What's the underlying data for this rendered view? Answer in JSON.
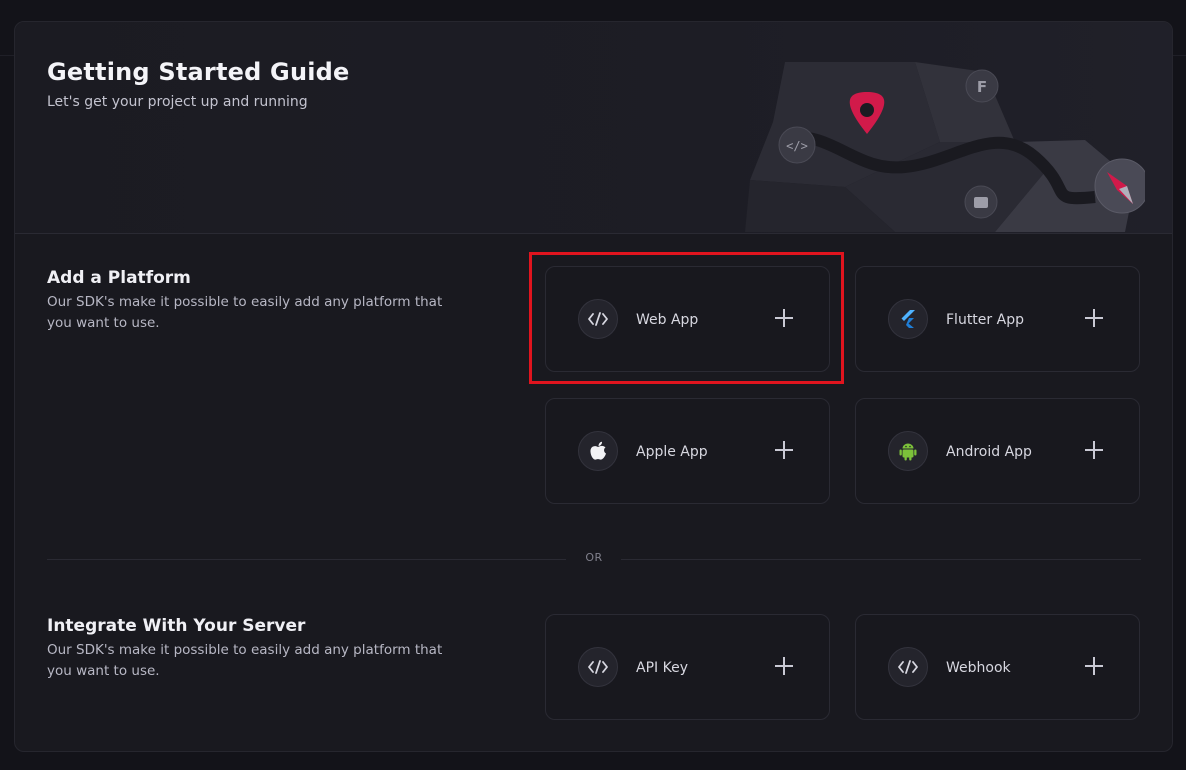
{
  "hero": {
    "title": "Getting Started Guide",
    "subtitle": "Let's get your project up and running"
  },
  "platform_section": {
    "title": "Add a Platform",
    "description": "Our SDK's make it possible to easily add any platform that you want to use.",
    "tiles": [
      {
        "label": "Web App",
        "icon": "code-icon"
      },
      {
        "label": "Flutter App",
        "icon": "flutter-icon"
      },
      {
        "label": "Apple App",
        "icon": "apple-icon"
      },
      {
        "label": "Android App",
        "icon": "android-icon"
      }
    ]
  },
  "divider": {
    "label": "OR"
  },
  "server_section": {
    "title": "Integrate With Your Server",
    "description": "Our SDK's make it possible to easily add any platform that you want to use.",
    "tiles": [
      {
        "label": "API Key",
        "icon": "code-icon"
      },
      {
        "label": "Webhook",
        "icon": "code-icon"
      }
    ]
  },
  "colors": {
    "background": "#131319",
    "card": "#19191f",
    "highlight": "#e0141e",
    "pin": "#d11a4a",
    "android": "#7cc13a",
    "flutter": "#4fb3ff"
  }
}
